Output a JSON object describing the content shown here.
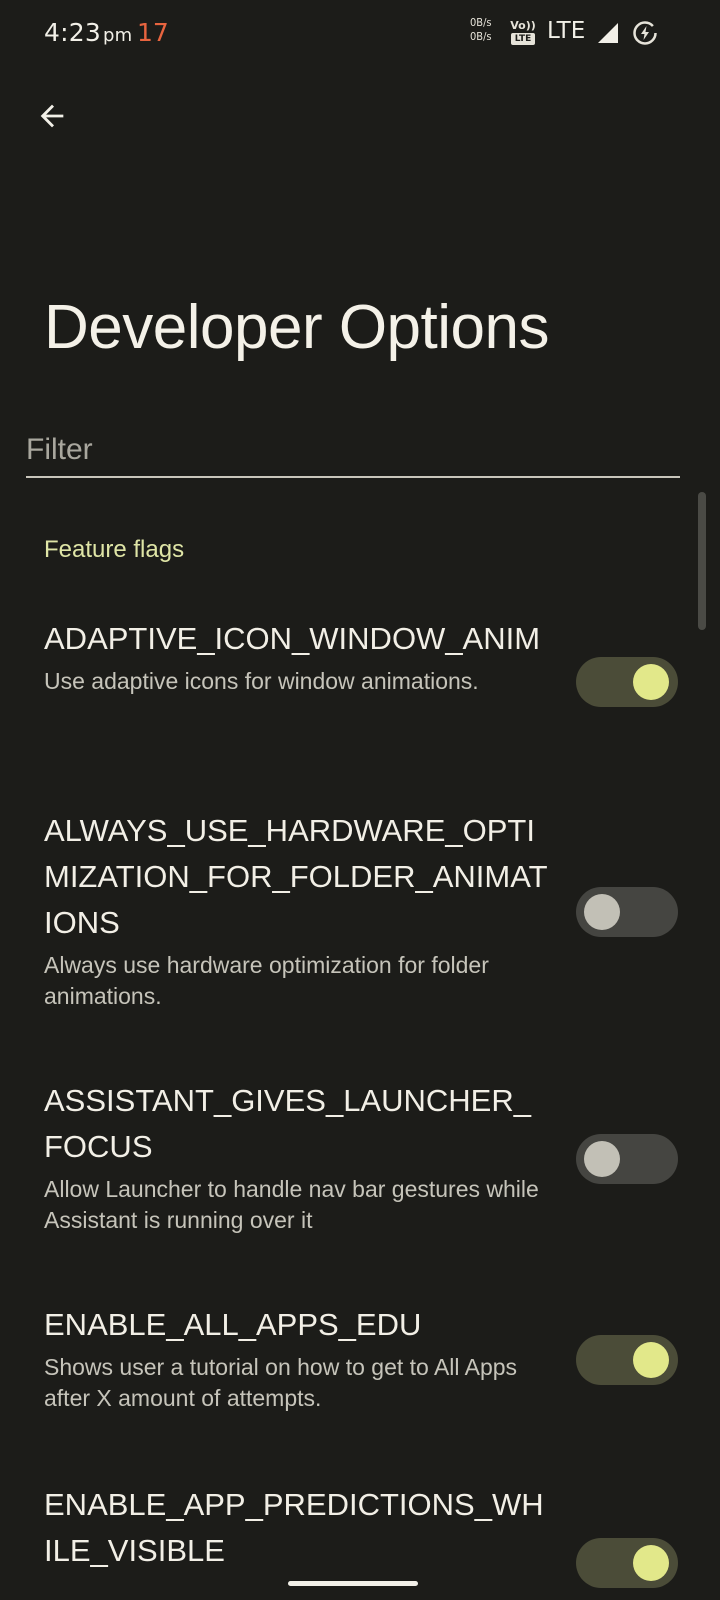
{
  "status_bar": {
    "time": "4:23",
    "ampm": "pm",
    "notification_count": "17",
    "net_up": "0B/s",
    "net_down": "0B/s",
    "volte_top": "Vo))",
    "volte_bottom": "LTE",
    "network": "LTE"
  },
  "header": {
    "title": "Developer Options"
  },
  "filter": {
    "placeholder": "Filter",
    "value": ""
  },
  "section": {
    "title": "Feature flags"
  },
  "flags": [
    {
      "title": "ADAPTIVE_ICON_WINDOW_ANIM",
      "description": "Use adaptive icons for window animations.",
      "enabled": true
    },
    {
      "title": "ALWAYS_USE_HARDWARE_OPTIMIZATION_FOR_FOLDER_ANIMATIONS",
      "description": "Always use hardware optimization for folder animations.",
      "enabled": false
    },
    {
      "title": "ASSISTANT_GIVES_LAUNCHER_FOCUS",
      "description": "Allow Launcher to handle nav bar gestures while Assistant is running over it",
      "enabled": false
    },
    {
      "title": "ENABLE_ALL_APPS_EDU",
      "description": "Shows user a tutorial on how to get to All Apps after X amount of attempts.",
      "enabled": true
    },
    {
      "title": "ENABLE_APP_PREDICTIONS_WHILE_VISIBLE",
      "description": "",
      "enabled": true
    }
  ],
  "colors": {
    "background": "#1c1c19",
    "accent": "#e2e88a",
    "section_header": "#dfe5a6",
    "notification_count": "#e8643f"
  },
  "icons": {
    "back": "arrow-back-icon",
    "signal": "signal-icon",
    "battery": "battery-charging-icon"
  }
}
